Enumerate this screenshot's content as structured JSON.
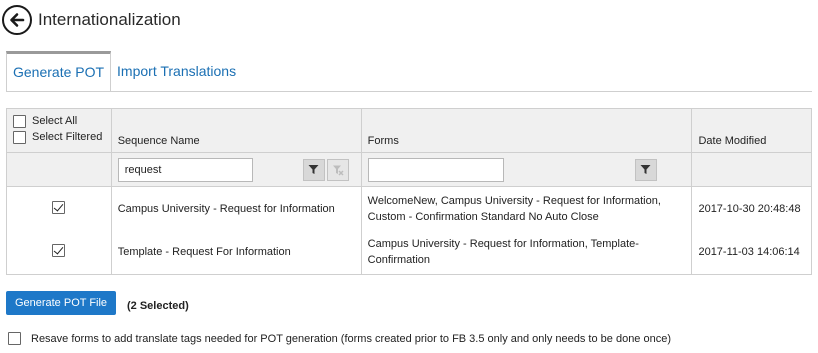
{
  "header": {
    "title": "Internationalization",
    "back_icon": "arrow-left-circle-icon"
  },
  "tabs": [
    {
      "label": "Generate POT",
      "active": true
    },
    {
      "label": "Import Translations",
      "active": false
    }
  ],
  "table": {
    "select_all_label": "Select All",
    "select_filtered_label": "Select Filtered",
    "columns": [
      "Sequence Name",
      "Forms",
      "Date Modified"
    ],
    "filters": {
      "sequence_value": "request",
      "forms_value": ""
    },
    "rows": [
      {
        "checked": true,
        "sequence": "Campus University - Request for Information",
        "forms_line1": "WelcomeNew, Campus University - Request for Information,",
        "forms_line2": "Custom - Confirmation Standard No Auto Close",
        "date": "2017-10-30 20:48:48"
      },
      {
        "checked": true,
        "sequence": "Template - Request For Information",
        "forms_line1": "Campus University - Request for Information, Template-",
        "forms_line2": "Confirmation",
        "date": "2017-11-03 14:06:14"
      }
    ]
  },
  "actions": {
    "generate_label": "Generate POT File",
    "selected_count": "(2 Selected)"
  },
  "resave": {
    "checked": false,
    "label": "Resave forms to add translate tags needed for POT generation (forms created prior to FB 3.5 only and only needs to be done once)"
  },
  "colors": {
    "accent": "#1e78c8",
    "link": "#1a6fb3",
    "header_bg": "#f0f0f0",
    "border": "#cfcfcf"
  }
}
